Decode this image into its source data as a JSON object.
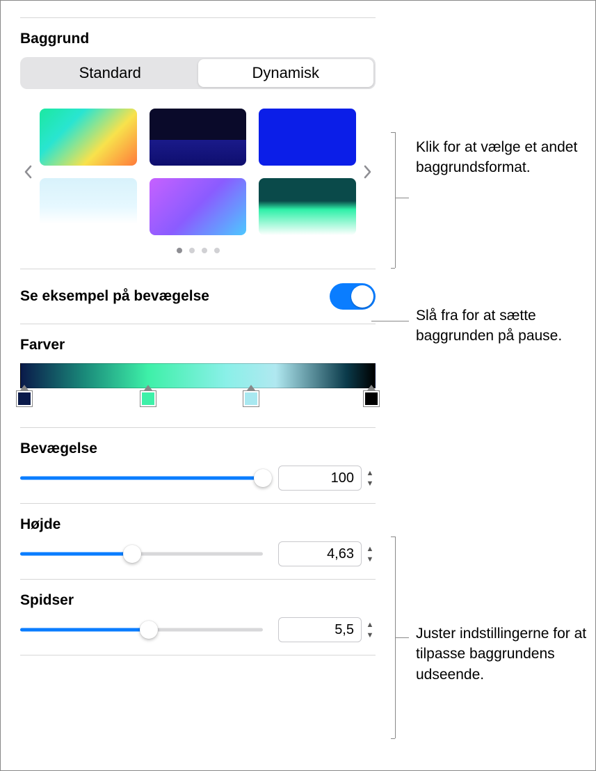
{
  "sections": {
    "background_title": "Baggrund",
    "colors_title": "Farver",
    "motion_title": "Bevægelse",
    "height_title": "Højde",
    "peaks_title": "Spidser"
  },
  "segmented": {
    "standard": "Standard",
    "dynamic": "Dynamisk",
    "active": "dynamic"
  },
  "preview_toggle": {
    "label": "Se eksempel på bevægelse",
    "on": true
  },
  "color_stops": [
    "#0a1a4a",
    "#3ef0a8",
    "#a8e8f0",
    "#000000"
  ],
  "sliders": {
    "motion": {
      "value": "100",
      "percent": 100
    },
    "height": {
      "value": "4,63",
      "percent": 46
    },
    "peaks": {
      "value": "5,5",
      "percent": 53
    }
  },
  "callouts": {
    "c1": "Klik for at vælge et andet baggrunds­format.",
    "c2": "Slå fra for at sætte baggrunden på pause.",
    "c3": "Juster indstillingerne for at tilpasse baggrundens udseende."
  }
}
